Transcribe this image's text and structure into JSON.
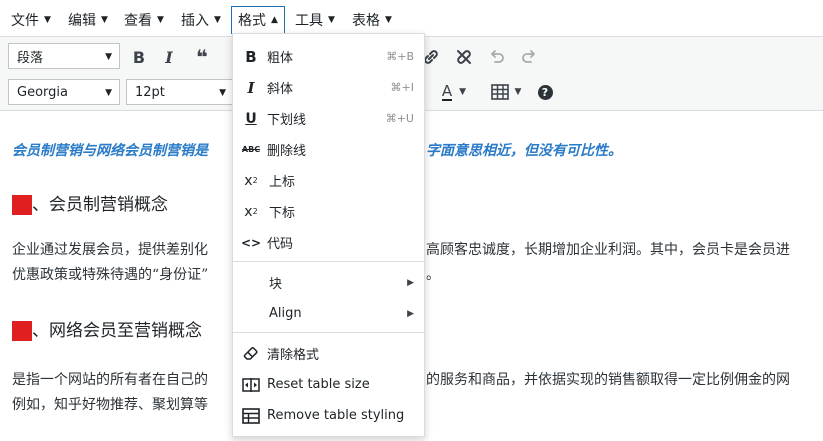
{
  "menubar": {
    "items": [
      {
        "label": "文件"
      },
      {
        "label": "编辑"
      },
      {
        "label": "查看"
      },
      {
        "label": "插入"
      },
      {
        "label": "格式"
      },
      {
        "label": "工具"
      },
      {
        "label": "表格"
      }
    ]
  },
  "toolbar": {
    "block_format": "段落",
    "font_family": "Georgia",
    "font_size": "12pt"
  },
  "format_menu": {
    "bold": {
      "label": "粗体",
      "shortcut": "⌘+B"
    },
    "italic": {
      "label": "斜体",
      "shortcut": "⌘+I"
    },
    "underline": {
      "label": "下划线",
      "shortcut": "⌘+U"
    },
    "strikethrough": {
      "label": "删除线"
    },
    "superscript": {
      "label": "上标"
    },
    "subscript": {
      "label": "下标"
    },
    "code": {
      "label": "代码"
    },
    "blocks": {
      "label": "块"
    },
    "align": {
      "label": "Align"
    },
    "clear_formatting": {
      "label": "清除格式"
    },
    "reset_table_size": {
      "label": "Reset table size"
    },
    "remove_table_styling": {
      "label": "Remove table styling"
    }
  },
  "content": {
    "intro_left": "会员制营销与网络会员制营销是",
    "intro_right": "字面意思相近，但没有可比性。",
    "h2_1": "、会员制营销概念",
    "para1_line1_left": "企业通过发展会员，提供差别化",
    "para1_line1_right": "高顾客忠诚度，长期增加企业利润。其中，会员卡是会员进",
    "para1_line2_left": "优惠政策或特殊待遇的“身份证”",
    "para1_line2_right": "。",
    "h2_2": "、网络会员至营销概念",
    "para2_line1_left": "是指一个网站的所有者在自己的",
    "para2_line1_right": "的服务和商品，并依据实现的销售额取得一定比例佣金的网",
    "para2_line2_left": "例如，知乎好物推荐、聚划算等"
  },
  "colors": {
    "accent": "#2271b1",
    "intro_text": "#2a7bc8",
    "heading_number_bg": "#e02020"
  }
}
